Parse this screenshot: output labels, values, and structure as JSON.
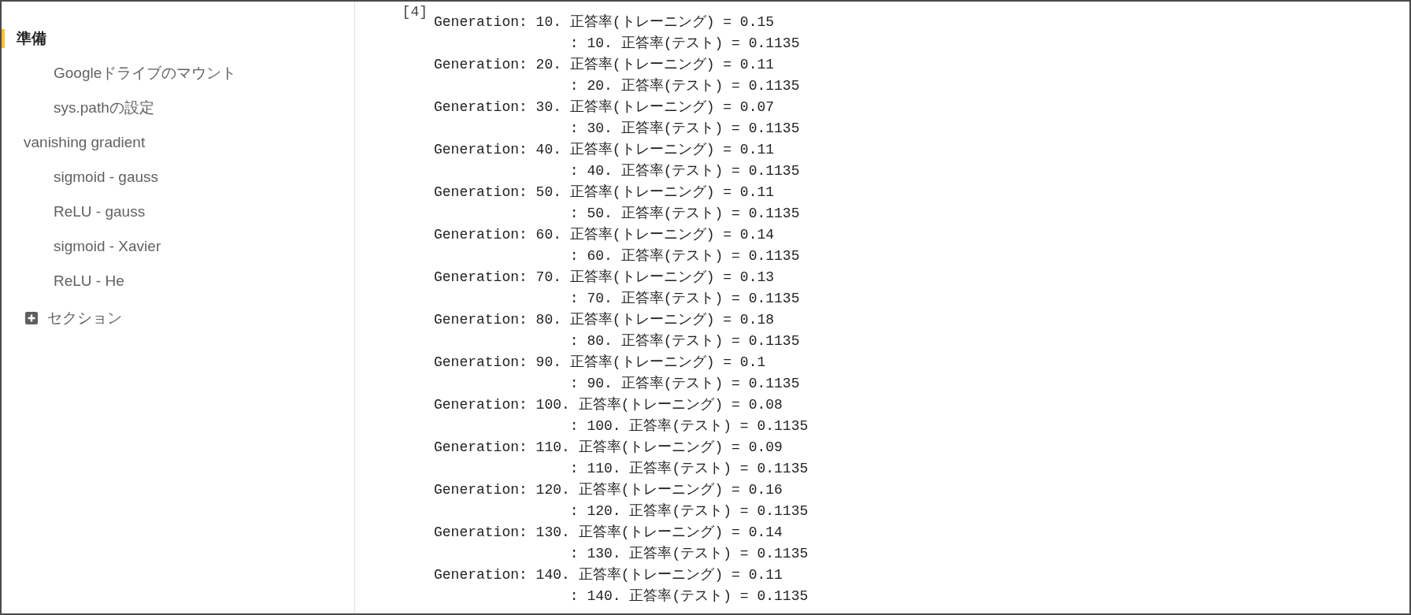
{
  "sidebar": {
    "items": [
      {
        "label": "準備",
        "selected": true,
        "children": [
          {
            "label": "Googleドライブのマウント",
            "selected": false
          },
          {
            "label": "sys.pathの設定",
            "selected": false
          }
        ]
      },
      {
        "label": "vanishing gradient",
        "selected": false,
        "children": [
          {
            "label": "sigmoid - gauss",
            "selected": false
          },
          {
            "label": "ReLU - gauss",
            "selected": false
          },
          {
            "label": "sigmoid - Xavier",
            "selected": false
          },
          {
            "label": "ReLU - He",
            "selected": false
          }
        ]
      }
    ],
    "add_section": {
      "label": "セクション"
    }
  },
  "cell": {
    "execution_count": "[4]",
    "output": [
      {
        "kind": "train",
        "text": "Generation: 10. 正答率(トレーニング) = 0.15"
      },
      {
        "kind": "test",
        "text": ": 10. 正答率(テスト) = 0.1135"
      },
      {
        "kind": "train",
        "text": "Generation: 20. 正答率(トレーニング) = 0.11"
      },
      {
        "kind": "test",
        "text": ": 20. 正答率(テスト) = 0.1135"
      },
      {
        "kind": "train",
        "text": "Generation: 30. 正答率(トレーニング) = 0.07"
      },
      {
        "kind": "test",
        "text": ": 30. 正答率(テスト) = 0.1135"
      },
      {
        "kind": "train",
        "text": "Generation: 40. 正答率(トレーニング) = 0.11"
      },
      {
        "kind": "test",
        "text": ": 40. 正答率(テスト) = 0.1135"
      },
      {
        "kind": "train",
        "text": "Generation: 50. 正答率(トレーニング) = 0.11"
      },
      {
        "kind": "test",
        "text": ": 50. 正答率(テスト) = 0.1135"
      },
      {
        "kind": "train",
        "text": "Generation: 60. 正答率(トレーニング) = 0.14"
      },
      {
        "kind": "test",
        "text": ": 60. 正答率(テスト) = 0.1135"
      },
      {
        "kind": "train",
        "text": "Generation: 70. 正答率(トレーニング) = 0.13"
      },
      {
        "kind": "test",
        "text": ": 70. 正答率(テスト) = 0.1135"
      },
      {
        "kind": "train",
        "text": "Generation: 80. 正答率(トレーニング) = 0.18"
      },
      {
        "kind": "test",
        "text": ": 80. 正答率(テスト) = 0.1135"
      },
      {
        "kind": "train",
        "text": "Generation: 90. 正答率(トレーニング) = 0.1"
      },
      {
        "kind": "test",
        "text": ": 90. 正答率(テスト) = 0.1135"
      },
      {
        "kind": "train",
        "text": "Generation: 100. 正答率(トレーニング) = 0.08"
      },
      {
        "kind": "test",
        "text": ": 100. 正答率(テスト) = 0.1135"
      },
      {
        "kind": "train",
        "text": "Generation: 110. 正答率(トレーニング) = 0.09"
      },
      {
        "kind": "test",
        "text": ": 110. 正答率(テスト) = 0.1135"
      },
      {
        "kind": "train",
        "text": "Generation: 120. 正答率(トレーニング) = 0.16"
      },
      {
        "kind": "test",
        "text": ": 120. 正答率(テスト) = 0.1135"
      },
      {
        "kind": "train",
        "text": "Generation: 130. 正答率(トレーニング) = 0.14"
      },
      {
        "kind": "test",
        "text": ": 130. 正答率(テスト) = 0.1135"
      },
      {
        "kind": "train",
        "text": "Generation: 140. 正答率(トレーニング) = 0.11"
      },
      {
        "kind": "test",
        "text": ": 140. 正答率(テスト) = 0.1135"
      }
    ]
  }
}
